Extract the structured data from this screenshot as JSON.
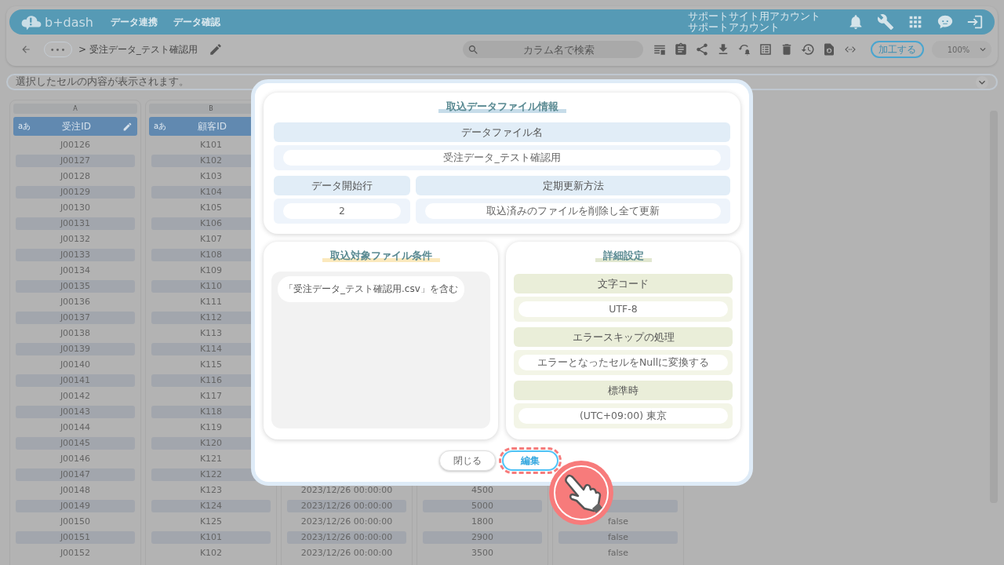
{
  "header": {
    "logo": "b+dash",
    "nav": [
      {
        "label": "データ連携"
      },
      {
        "label": "データ確認"
      }
    ],
    "account": [
      "サポートサイト用アカウント",
      "サポートアカウント"
    ]
  },
  "toolbar": {
    "more": "•••",
    "breadcrumb": "> 受注データ_テスト確認用",
    "search": {
      "placeholder": "カラム名で検索"
    },
    "process_button": "加工する",
    "zoom": "100%"
  },
  "cell_viewer": {
    "placeholder": "選択したセルの内容が表示されます。"
  },
  "grid": {
    "columns": [
      {
        "letter": "A",
        "type_label": "aあ",
        "name": "受注ID",
        "editable": true,
        "values": [
          "J00126",
          "J00127",
          "J00128",
          "J00129",
          "J00130",
          "J00131",
          "J00132",
          "J00133",
          "J00134",
          "J00135",
          "J00136",
          "J00137",
          "J00138",
          "J00139",
          "J00140",
          "J00141",
          "J00142",
          "J00143",
          "J00144",
          "J00145",
          "J00146",
          "J00147",
          "J00148",
          "J00149",
          "J00150",
          "J00151",
          "J00152"
        ]
      },
      {
        "letter": "B",
        "type_label": "aあ",
        "name": "顧客ID",
        "values": [
          "K101",
          "K102",
          "K103",
          "K104",
          "K105",
          "K106",
          "K107",
          "K108",
          "K109",
          "K110",
          "K111",
          "K112",
          "K113",
          "K114",
          "K115",
          "K116",
          "K117",
          "K118",
          "K119",
          "K120",
          "K121",
          "K122",
          "K123",
          "K124",
          "K125",
          "K101",
          "K102"
        ]
      },
      {
        "values": [
          "2023/12/26 00:00:00",
          "2023/12/26 00:00:00",
          "2023/12/26 00:00:00",
          "2023/12/26 00:00:00",
          "2023/12/26 00:00:00"
        ]
      },
      {
        "values": [
          "4500",
          "5000",
          "1800",
          "2900",
          "3500"
        ]
      },
      {
        "values": [
          "false",
          "false",
          "false"
        ]
      }
    ]
  },
  "dialog": {
    "file_info": {
      "title": "取込データファイル情報",
      "fields": [
        {
          "label": "データファイル名",
          "value": "受注データ_テスト確認用"
        },
        {
          "label": "データ開始行",
          "value": "2"
        },
        {
          "label": "定期更新方法",
          "value": "取込済みのファイルを削除し全て更新"
        }
      ]
    },
    "conditions": {
      "title": "取込対象ファイル条件",
      "items": [
        "「受注データ_テスト確認用.csv」を含む"
      ]
    },
    "details": {
      "title": "詳細設定",
      "fields": [
        {
          "label": "文字コード",
          "value": "UTF-8"
        },
        {
          "label": "エラースキップの処理",
          "value": "エラーとなったセルをNullに変換する"
        },
        {
          "label": "標準時",
          "value": "(UTC+09:00) 東京"
        }
      ]
    },
    "buttons": [
      {
        "label": "閉じる",
        "kind": "secondary",
        "highlighted": false
      },
      {
        "label": "編集",
        "kind": "primary",
        "highlighted": true
      }
    ]
  }
}
